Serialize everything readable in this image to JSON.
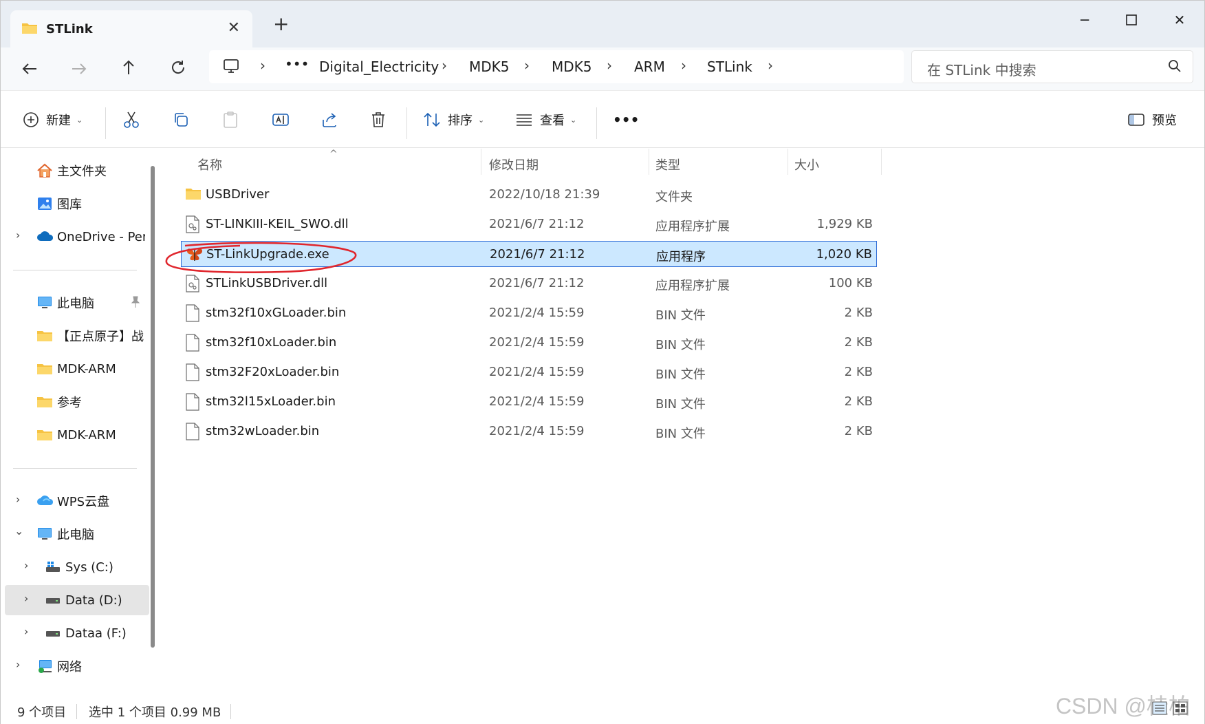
{
  "window": {
    "tab_title": "STLink",
    "new_tab": "+",
    "controls": {
      "minimize": "─",
      "maximize": "☐",
      "close": "✕"
    }
  },
  "nav": {
    "breadcrumb": [
      "Digital_Electricity",
      "MDK5",
      "MDK5",
      "ARM",
      "STLink"
    ],
    "more": "•••",
    "sep": "›",
    "search_placeholder": "在 STLink 中搜索"
  },
  "toolbar": {
    "new_label": "新建",
    "sort_label": "排序",
    "view_label": "查看",
    "more_label": "•••",
    "preview_label": "预览"
  },
  "sidebar": {
    "quick": [
      {
        "label": "主文件夹",
        "icon": "home-icon"
      },
      {
        "label": "图库",
        "icon": "gallery-icon"
      },
      {
        "label": "OneDrive - Per",
        "icon": "cloud-icon",
        "expandable": true
      }
    ],
    "pinned": [
      {
        "label": "此电脑",
        "icon": "computer-icon",
        "pinned": true
      },
      {
        "label": "【正点原子】战",
        "icon": "folder-icon"
      },
      {
        "label": "MDK-ARM",
        "icon": "folder-icon"
      },
      {
        "label": "参考",
        "icon": "folder-icon"
      },
      {
        "label": "MDK-ARM",
        "icon": "folder-icon"
      }
    ],
    "tree": [
      {
        "label": "WPS云盘",
        "icon": "wps-cloud-icon"
      },
      {
        "label": "此电脑",
        "icon": "computer-icon",
        "expanded": true
      },
      {
        "label": "Sys (C:)",
        "icon": "drive-icon"
      },
      {
        "label": "Data (D:)",
        "icon": "drive-icon",
        "selected": true
      },
      {
        "label": "Dataa (F:)",
        "icon": "drive-icon"
      },
      {
        "label": "网络",
        "icon": "network-icon"
      }
    ]
  },
  "columns": {
    "name": "名称",
    "date": "修改日期",
    "type": "类型",
    "size": "大小"
  },
  "files": [
    {
      "name": "USBDriver",
      "date": "2022/10/18 21:39",
      "type": "文件夹",
      "size": "",
      "icon": "folder-icon"
    },
    {
      "name": "ST-LINKIII-KEIL_SWO.dll",
      "date": "2021/6/7 21:12",
      "type": "应用程序扩展",
      "size": "1,929 KB",
      "icon": "dll-icon"
    },
    {
      "name": "ST-LinkUpgrade.exe",
      "date": "2021/6/7 21:12",
      "type": "应用程序",
      "size": "1,020 KB",
      "icon": "butterfly-exe-icon",
      "selected": true
    },
    {
      "name": "STLinkUSBDriver.dll",
      "date": "2021/6/7 21:12",
      "type": "应用程序扩展",
      "size": "100 KB",
      "icon": "dll-icon"
    },
    {
      "name": "stm32f10xGLoader.bin",
      "date": "2021/2/4 15:59",
      "type": "BIN 文件",
      "size": "2 KB",
      "icon": "file-icon"
    },
    {
      "name": "stm32f10xLoader.bin",
      "date": "2021/2/4 15:59",
      "type": "BIN 文件",
      "size": "2 KB",
      "icon": "file-icon"
    },
    {
      "name": "stm32F20xLoader.bin",
      "date": "2021/2/4 15:59",
      "type": "BIN 文件",
      "size": "2 KB",
      "icon": "file-icon"
    },
    {
      "name": "stm32l15xLoader.bin",
      "date": "2021/2/4 15:59",
      "type": "BIN 文件",
      "size": "2 KB",
      "icon": "file-icon"
    },
    {
      "name": "stm32wLoader.bin",
      "date": "2021/2/4 15:59",
      "type": "BIN 文件",
      "size": "2 KB",
      "icon": "file-icon"
    }
  ],
  "status": {
    "count": "9 个项目",
    "selection": "选中 1 个项目  0.99 MB"
  },
  "watermark": "CSDN @桂柏",
  "colors": {
    "selection_bg": "#cce8ff",
    "selection_border": "#2d6bd6",
    "annotation": "#e0262d",
    "folder": "#f6c343"
  }
}
